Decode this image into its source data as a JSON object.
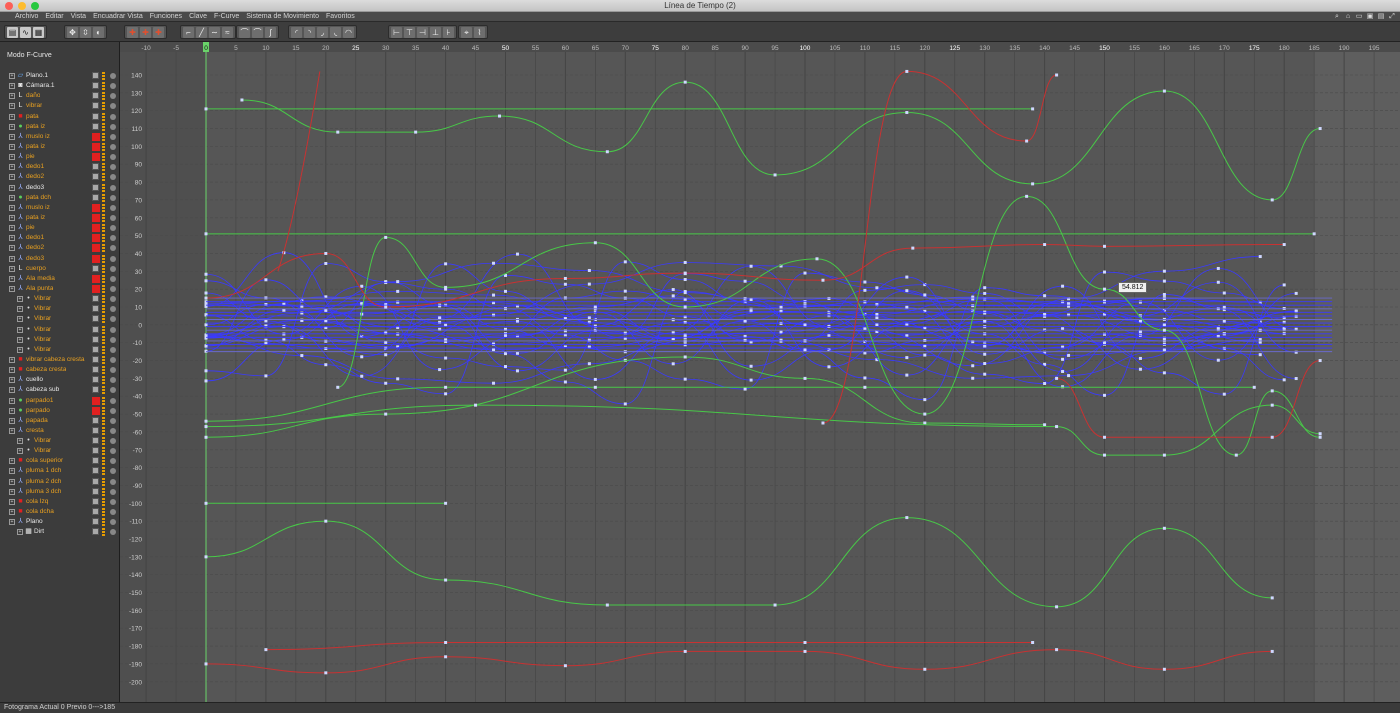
{
  "window": {
    "title": "Línea de Tiempo (2)"
  },
  "menu": [
    "Archivo",
    "Editar",
    "Vista",
    "Encuadrar Vista",
    "Funciones",
    "Clave",
    "F-Curve",
    "Sistema de Movimiento",
    "Favoritos"
  ],
  "left_panel": {
    "mode_label": "Modo F-Curve"
  },
  "objects": [
    {
      "name": "Plano.1",
      "color": "#e8e8e8",
      "indent": 0,
      "icon": "plane-icon",
      "tag": "check"
    },
    {
      "name": "Cámara.1",
      "color": "#e8e8e8",
      "indent": 0,
      "icon": "camera-icon",
      "tag": "check"
    },
    {
      "name": "daño",
      "color": "#e8a020",
      "indent": 0,
      "icon": "null-icon",
      "tag": "check"
    },
    {
      "name": "vibrar",
      "color": "#e8a020",
      "indent": 0,
      "icon": "null-icon",
      "tag": "check"
    },
    {
      "name": "pata",
      "color": "#e8a020",
      "indent": 0,
      "icon": "polygon-icon",
      "tag": "check"
    },
    {
      "name": "pata iz",
      "color": "#e8a020",
      "indent": 0,
      "icon": "sphere-icon",
      "tag": "check"
    },
    {
      "name": "muslo iz",
      "color": "#e8a020",
      "indent": 0,
      "icon": "joint-icon",
      "tag": "red"
    },
    {
      "name": "pata iz",
      "color": "#e8a020",
      "indent": 0,
      "icon": "joint-icon",
      "tag": "red"
    },
    {
      "name": "pie",
      "color": "#e8a020",
      "indent": 0,
      "icon": "joint-icon",
      "tag": "red"
    },
    {
      "name": "dedo1",
      "color": "#e8a020",
      "indent": 0,
      "icon": "joint-icon",
      "tag": "check"
    },
    {
      "name": "dedo2",
      "color": "#e8a020",
      "indent": 0,
      "icon": "joint-icon",
      "tag": "check"
    },
    {
      "name": "dedo3",
      "color": "#e8e8e8",
      "indent": 0,
      "icon": "joint-icon",
      "tag": "check"
    },
    {
      "name": "pata dch",
      "color": "#e8a020",
      "indent": 0,
      "icon": "sphere-icon",
      "tag": "check"
    },
    {
      "name": "muslo iz",
      "color": "#e8a020",
      "indent": 0,
      "icon": "joint-icon",
      "tag": "red"
    },
    {
      "name": "pata iz",
      "color": "#e8a020",
      "indent": 0,
      "icon": "joint-icon",
      "tag": "red"
    },
    {
      "name": "pie",
      "color": "#e8a020",
      "indent": 0,
      "icon": "joint-icon",
      "tag": "red"
    },
    {
      "name": "dedo1",
      "color": "#e8a020",
      "indent": 0,
      "icon": "joint-icon",
      "tag": "red"
    },
    {
      "name": "dedo2",
      "color": "#e8a020",
      "indent": 0,
      "icon": "joint-icon",
      "tag": "red"
    },
    {
      "name": "dedo3",
      "color": "#e8a020",
      "indent": 0,
      "icon": "joint-icon",
      "tag": "red"
    },
    {
      "name": "cuerpo",
      "color": "#e8a020",
      "indent": 0,
      "icon": "null-icon",
      "tag": "check"
    },
    {
      "name": "Ala media",
      "color": "#e8a020",
      "indent": 0,
      "icon": "joint-icon",
      "tag": "red"
    },
    {
      "name": "Ala punta",
      "color": "#e8a020",
      "indent": 0,
      "icon": "joint-icon",
      "tag": "red"
    },
    {
      "name": "Vibrar",
      "color": "#e8a020",
      "indent": 1,
      "icon": "tag-icon",
      "tag": "check"
    },
    {
      "name": "Vibrar",
      "color": "#e8a020",
      "indent": 1,
      "icon": "tag-icon",
      "tag": "check"
    },
    {
      "name": "Vibrar",
      "color": "#e8a020",
      "indent": 1,
      "icon": "tag-icon",
      "tag": "check"
    },
    {
      "name": "Vibrar",
      "color": "#e8a020",
      "indent": 1,
      "icon": "tag-icon",
      "tag": "check"
    },
    {
      "name": "Vibrar",
      "color": "#e8a020",
      "indent": 1,
      "icon": "tag-icon",
      "tag": "check"
    },
    {
      "name": "Vibrar",
      "color": "#e8a020",
      "indent": 1,
      "icon": "tag-icon",
      "tag": "check"
    },
    {
      "name": "vibrar cabeza cresta",
      "color": "#e8a020",
      "indent": 0,
      "icon": "polygon-icon",
      "tag": "check"
    },
    {
      "name": "cabeza cresta",
      "color": "#e8a020",
      "indent": 0,
      "icon": "polygon-icon",
      "tag": "check"
    },
    {
      "name": "cuello",
      "color": "#e8e8e8",
      "indent": 0,
      "icon": "joint-icon",
      "tag": "check"
    },
    {
      "name": "cabeza sub",
      "color": "#e8e8e8",
      "indent": 0,
      "icon": "joint-icon",
      "tag": "check"
    },
    {
      "name": "parpado1",
      "color": "#e8a020",
      "indent": 0,
      "icon": "sphere-icon",
      "tag": "red"
    },
    {
      "name": "parpado",
      "color": "#e8a020",
      "indent": 0,
      "icon": "sphere-icon",
      "tag": "red"
    },
    {
      "name": "papada",
      "color": "#e8a020",
      "indent": 0,
      "icon": "joint-icon",
      "tag": "check"
    },
    {
      "name": "cresta",
      "color": "#e8a020",
      "indent": 0,
      "icon": "joint-icon",
      "tag": "check"
    },
    {
      "name": "Vibrar",
      "color": "#e8a020",
      "indent": 1,
      "icon": "tag-icon",
      "tag": "check"
    },
    {
      "name": "Vibrar",
      "color": "#e8a020",
      "indent": 1,
      "icon": "tag-icon",
      "tag": "check"
    },
    {
      "name": "cola superior",
      "color": "#e8a020",
      "indent": 0,
      "icon": "polygon-icon",
      "tag": "check"
    },
    {
      "name": "pluma 1 dch",
      "color": "#e8a020",
      "indent": 0,
      "icon": "joint-icon",
      "tag": "check"
    },
    {
      "name": "pluma 2 dch",
      "color": "#e8a020",
      "indent": 0,
      "icon": "joint-icon",
      "tag": "check"
    },
    {
      "name": "pluma 3 dch",
      "color": "#e8a020",
      "indent": 0,
      "icon": "joint-icon",
      "tag": "check"
    },
    {
      "name": "cola Izq",
      "color": "#e8a020",
      "indent": 0,
      "icon": "polygon-icon",
      "tag": "check"
    },
    {
      "name": "cola dcha",
      "color": "#e8a020",
      "indent": 0,
      "icon": "polygon-icon",
      "tag": "check"
    },
    {
      "name": "Plano",
      "color": "#e8e8e8",
      "indent": 0,
      "icon": "joint-icon",
      "tag": "check"
    },
    {
      "name": "Dirt",
      "color": "#e8e8e8",
      "indent": 1,
      "icon": "checker-icon",
      "tag": "check"
    }
  ],
  "timeline": {
    "frame_labels": [
      "-10",
      "-5",
      "0",
      "5",
      "10",
      "15",
      "20",
      "25",
      "30",
      "35",
      "40",
      "45",
      "50",
      "55",
      "60",
      "65",
      "70",
      "75",
      "80",
      "85",
      "90",
      "95",
      "100",
      "105",
      "110",
      "115",
      "120",
      "125",
      "130",
      "135",
      "140",
      "145",
      "150",
      "155",
      "160",
      "165",
      "170",
      "175",
      "180",
      "185",
      "190",
      "195"
    ],
    "value_labels": [
      "140",
      "130",
      "120",
      "110",
      "100",
      "90",
      "80",
      "70",
      "60",
      "50",
      "40",
      "30",
      "20",
      "10",
      "0",
      "-10",
      "-20",
      "-30",
      "-40",
      "-50",
      "-60",
      "-70",
      "-80",
      "-90",
      "-100",
      "-110",
      "-120",
      "-130",
      "-140",
      "-150",
      "-160",
      "-170",
      "-180",
      "-190",
      "-200"
    ],
    "current_frame": "0",
    "end_frame": "185",
    "value_tooltip": "54.812"
  },
  "status": {
    "text": "Fotograma Actual  0  Previo  0--->185"
  },
  "colors": {
    "green": "#48c848",
    "red": "#c83232",
    "blue": "#3a3aff",
    "playhead": "#6ad46a"
  }
}
